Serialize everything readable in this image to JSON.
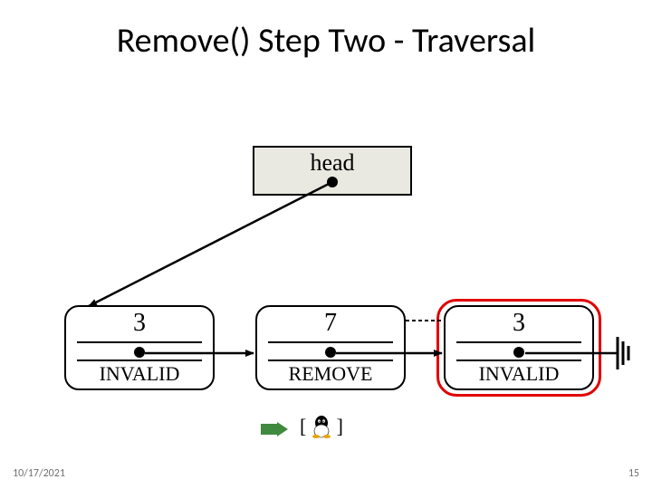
{
  "title": "Remove() Step Two - Traversal",
  "head": {
    "label": "head"
  },
  "nodes": {
    "n1": {
      "value": "3",
      "state": "INVALID"
    },
    "n2": {
      "value": "7",
      "state": "REMOVE"
    },
    "n3": {
      "value": "3",
      "state": "INVALID"
    }
  },
  "brackets": {
    "left": "[",
    "right": "]"
  },
  "footer": {
    "date": "10/17/2021",
    "page": "15"
  }
}
